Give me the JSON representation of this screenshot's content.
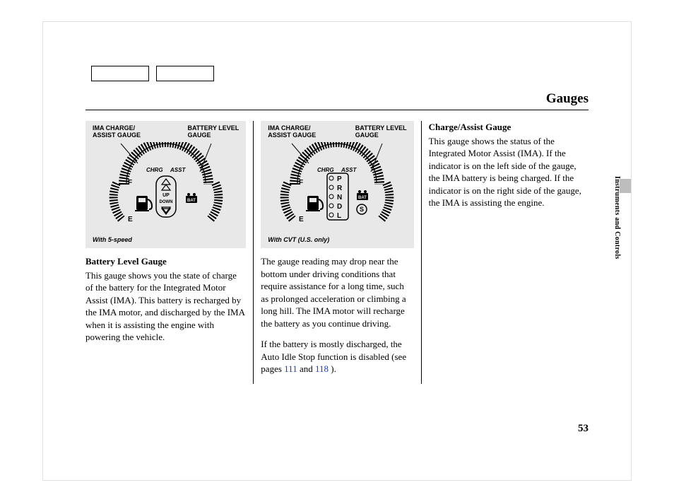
{
  "header": {
    "title": "Gauges"
  },
  "top_boxes": [
    "",
    ""
  ],
  "diagram": {
    "label_left_l1": "IMA CHARGE/",
    "label_left_l2": "ASSIST GAUGE",
    "label_right_l1": "BATTERY LEVEL",
    "label_right_l2": "GAUGE",
    "arc_chrg": "CHRG",
    "arc_asst": "ASST",
    "fuel_f": "F",
    "fuel_e": "E",
    "bat_icon": "BAT",
    "up": "UP",
    "down": "DOWN",
    "prndl": [
      "P",
      "R",
      "N",
      "D",
      "L"
    ],
    "s_badge": "S",
    "caption1": "With 5-speed",
    "caption2": "With CVT (U.S. only)"
  },
  "col1": {
    "title": "Battery Level Gauge",
    "p1": "This gauge shows you the state of charge of the battery for the Integrated Motor Assist (IMA). This battery is recharged by the IMA motor, and discharged by the IMA when it is assisting the engine with powering the vehicle."
  },
  "col2": {
    "p1": "The gauge reading may drop near the bottom under driving conditions that require assistance for a long time, such as prolonged acceleration or climbing a long hill. The IMA motor will recharge the battery as you continue driving.",
    "p2a": "If the battery is mostly discharged, the Auto Idle Stop function is disabled (see pages ",
    "link1": "111",
    "p2b": " and ",
    "link2": "118",
    "p2c": " )."
  },
  "col3": {
    "title": "Charge/Assist Gauge",
    "p1": "This gauge shows the status of the Integrated Motor Assist (IMA). If the indicator is on the left side of the gauge, the IMA battery is being charged. If the indicator is on the right side of the gauge, the IMA is assisting the engine."
  },
  "side": {
    "section": "Instruments and Controls"
  },
  "page_number": "53"
}
